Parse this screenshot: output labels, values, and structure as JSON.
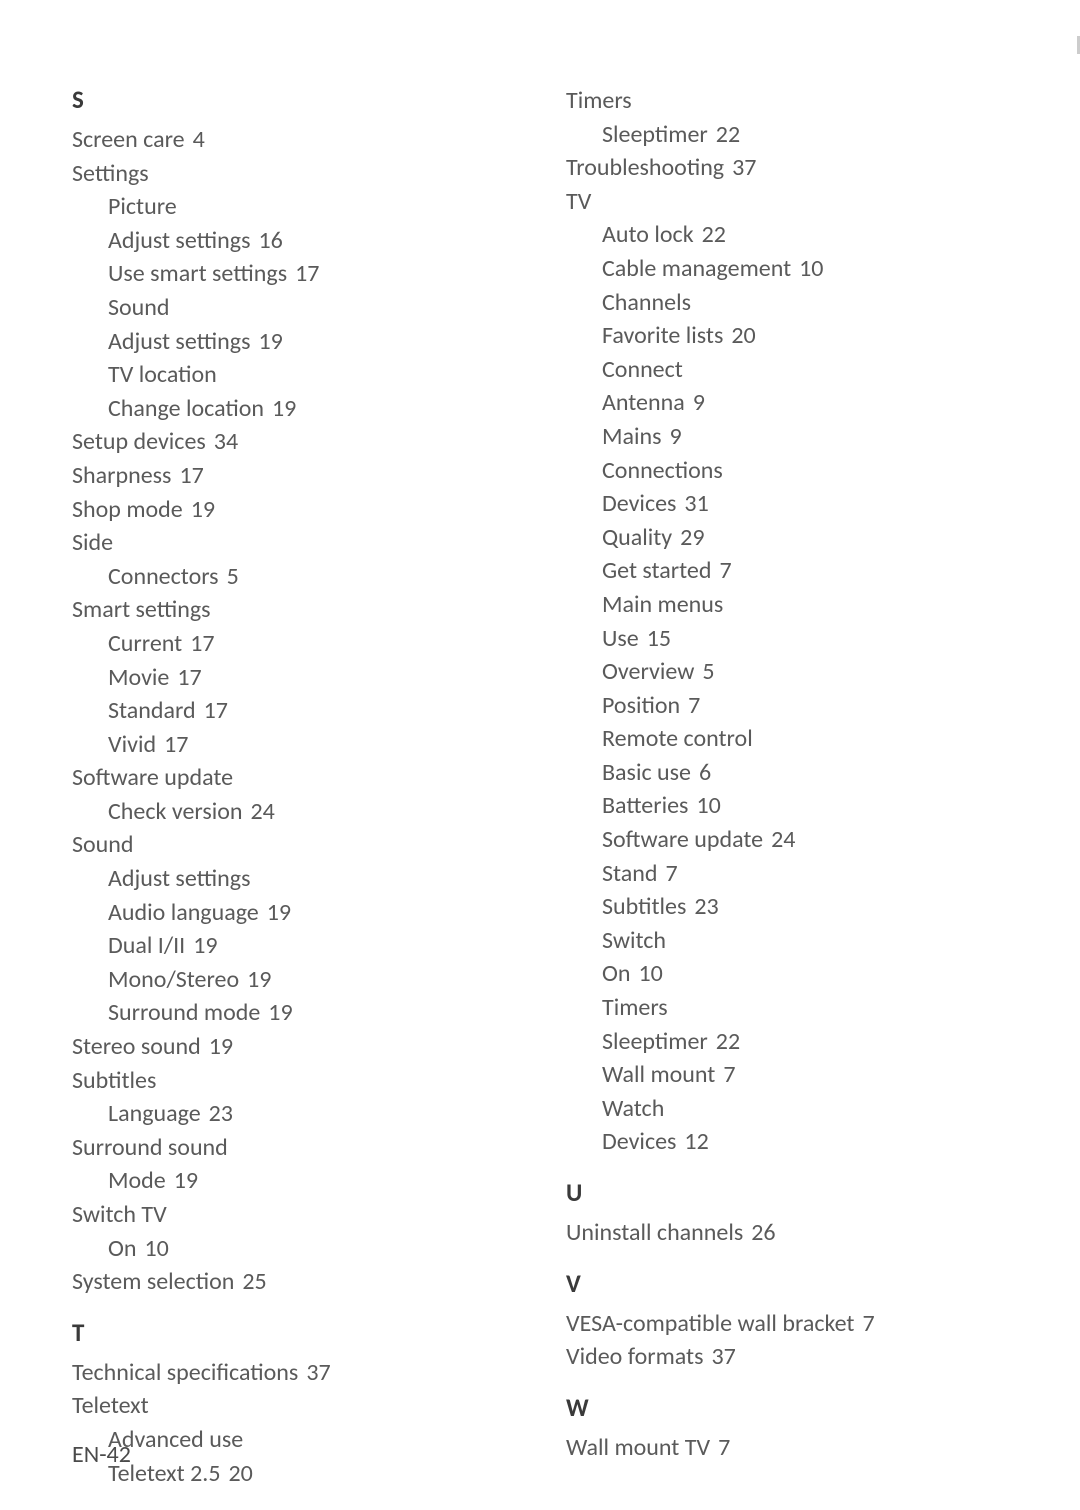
{
  "footer": "EN-42",
  "columns": [
    {
      "sections": [
        {
          "letter": "S",
          "items": [
            {
              "indent": 0,
              "text": "Screen care",
              "page": "4"
            },
            {
              "indent": 0,
              "text": "Settings"
            },
            {
              "indent": 1,
              "text": "Picture"
            },
            {
              "indent": 1,
              "text": "Adjust settings",
              "page": "16"
            },
            {
              "indent": 1,
              "text": "Use smart settings",
              "page": "17"
            },
            {
              "indent": 1,
              "text": "Sound"
            },
            {
              "indent": 1,
              "text": "Adjust settings",
              "page": "19"
            },
            {
              "indent": 1,
              "text": "TV location"
            },
            {
              "indent": 1,
              "text": "Change location",
              "page": "19"
            },
            {
              "indent": 0,
              "text": "Setup devices",
              "page": "34"
            },
            {
              "indent": 0,
              "text": "Sharpness",
              "page": "17"
            },
            {
              "indent": 0,
              "text": "Shop mode",
              "page": "19"
            },
            {
              "indent": 0,
              "text": "Side"
            },
            {
              "indent": 1,
              "text": "Connectors",
              "page": "5"
            },
            {
              "indent": 0,
              "text": "Smart settings"
            },
            {
              "indent": 1,
              "text": "Current",
              "page": "17"
            },
            {
              "indent": 1,
              "text": "Movie",
              "page": "17"
            },
            {
              "indent": 1,
              "text": "Standard",
              "page": "17"
            },
            {
              "indent": 1,
              "text": "Vivid",
              "page": "17"
            },
            {
              "indent": 0,
              "text": "Software update"
            },
            {
              "indent": 1,
              "text": "Check version",
              "page": "24"
            },
            {
              "indent": 0,
              "text": "Sound"
            },
            {
              "indent": 1,
              "text": "Adjust settings"
            },
            {
              "indent": 1,
              "text": "Audio language",
              "page": "19"
            },
            {
              "indent": 1,
              "text": "Dual I/II",
              "page": "19"
            },
            {
              "indent": 1,
              "text": "Mono/Stereo",
              "page": "19"
            },
            {
              "indent": 1,
              "text": "Surround mode",
              "page": "19"
            },
            {
              "indent": 0,
              "text": "Stereo sound",
              "page": "19"
            },
            {
              "indent": 0,
              "text": "Subtitles"
            },
            {
              "indent": 1,
              "text": "Language",
              "page": "23"
            },
            {
              "indent": 0,
              "text": "Surround sound"
            },
            {
              "indent": 1,
              "text": "Mode",
              "page": "19"
            },
            {
              "indent": 0,
              "text": "Switch TV"
            },
            {
              "indent": 1,
              "text": "On",
              "page": "10"
            },
            {
              "indent": 0,
              "text": "System selection",
              "page": "25"
            }
          ]
        },
        {
          "letter": "T",
          "items": [
            {
              "indent": 0,
              "text": "Technical specifications",
              "page": "37"
            },
            {
              "indent": 0,
              "text": "Teletext"
            },
            {
              "indent": 1,
              "text": "Advanced use"
            },
            {
              "indent": 1,
              "text": "Teletext 2.5",
              "page": "20"
            }
          ]
        }
      ]
    },
    {
      "sections": [
        {
          "letter": "",
          "items": [
            {
              "indent": 0,
              "text": "Timers"
            },
            {
              "indent": 1,
              "text": "Sleeptimer",
              "page": "22"
            },
            {
              "indent": 0,
              "text": "Troubleshooting",
              "page": "37"
            },
            {
              "indent": 0,
              "text": "TV"
            },
            {
              "indent": 1,
              "text": "Auto lock",
              "page": "22"
            },
            {
              "indent": 1,
              "text": "Cable management",
              "page": "10"
            },
            {
              "indent": 1,
              "text": "Channels"
            },
            {
              "indent": 1,
              "text": "Favorite lists",
              "page": "20"
            },
            {
              "indent": 1,
              "text": "Connect"
            },
            {
              "indent": 1,
              "text": "Antenna",
              "page": "9"
            },
            {
              "indent": 1,
              "text": "Mains",
              "page": "9"
            },
            {
              "indent": 1,
              "text": "Connections"
            },
            {
              "indent": 1,
              "text": "Devices",
              "page": "31"
            },
            {
              "indent": 1,
              "text": "Quality",
              "page": "29"
            },
            {
              "indent": 1,
              "text": "Get started",
              "page": "7"
            },
            {
              "indent": 1,
              "text": "Main menus"
            },
            {
              "indent": 1,
              "text": "Use",
              "page": "15"
            },
            {
              "indent": 1,
              "text": "Overview",
              "page": "5"
            },
            {
              "indent": 1,
              "text": "Position",
              "page": "7"
            },
            {
              "indent": 1,
              "text": "Remote control"
            },
            {
              "indent": 1,
              "text": "Basic use",
              "page": "6"
            },
            {
              "indent": 1,
              "text": "Batteries",
              "page": "10"
            },
            {
              "indent": 1,
              "text": "Software update",
              "page": "24"
            },
            {
              "indent": 1,
              "text": "Stand",
              "page": "7"
            },
            {
              "indent": 1,
              "text": "Subtitles",
              "page": "23"
            },
            {
              "indent": 1,
              "text": "Switch"
            },
            {
              "indent": 1,
              "text": "On",
              "page": "10"
            },
            {
              "indent": 1,
              "text": "Timers"
            },
            {
              "indent": 1,
              "text": "Sleeptimer",
              "page": "22"
            },
            {
              "indent": 1,
              "text": "Wall mount",
              "page": "7"
            },
            {
              "indent": 1,
              "text": "Watch"
            },
            {
              "indent": 1,
              "text": "Devices",
              "page": "12"
            }
          ]
        },
        {
          "letter": "U",
          "items": [
            {
              "indent": 0,
              "text": "Uninstall channels",
              "page": "26"
            }
          ]
        },
        {
          "letter": "V",
          "items": [
            {
              "indent": 0,
              "text": "VESA-compatible wall bracket",
              "page": "7"
            },
            {
              "indent": 0,
              "text": "Video formats",
              "page": "37"
            }
          ]
        },
        {
          "letter": "W",
          "items": [
            {
              "indent": 0,
              "text": "Wall mount TV",
              "page": "7"
            }
          ]
        }
      ]
    }
  ]
}
